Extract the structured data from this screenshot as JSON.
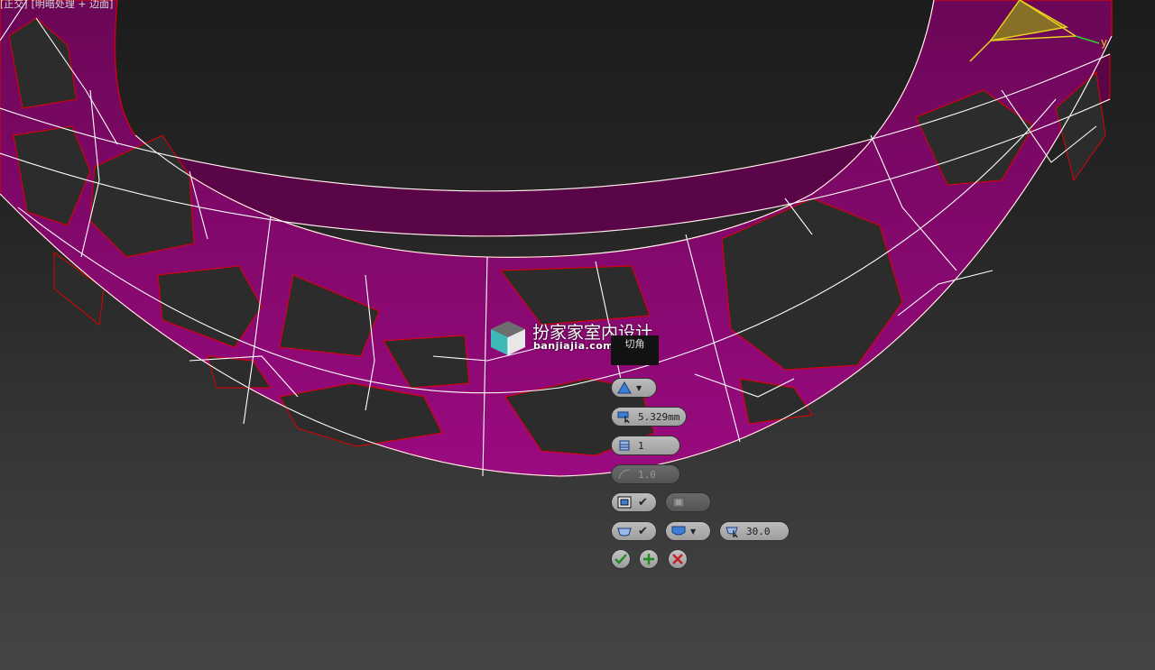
{
  "viewport": {
    "label_items": [
      "[正交]",
      "[明暗处理 + 边面]"
    ],
    "axis_label": "y"
  },
  "watermark": {
    "name": "扮家家室内设计",
    "url": "banjiajia.com"
  },
  "caddy": {
    "title": "切角",
    "amount": "5.329mm",
    "segments": "1",
    "tension": "1.0",
    "smooth_threshold": "30.0",
    "apply_label": "OK",
    "apply_continue_label": "Apply and Continue",
    "cancel_label": "Cancel"
  },
  "colors": {
    "mesh_face": "#8a0a72",
    "mesh_face_dark": "#4a0438",
    "edge_white": "#ffffff",
    "edge_red": "#e00000",
    "gizmo": "#e6d21e"
  }
}
